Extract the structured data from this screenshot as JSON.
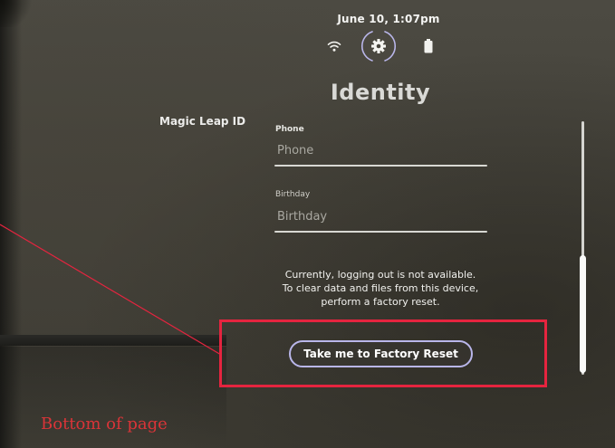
{
  "status_bar": {
    "date_time": "June 10, 1:07pm",
    "icons": [
      "wifi-icon",
      "settings-icon",
      "battery-icon"
    ]
  },
  "page": {
    "title": "Identity"
  },
  "sidebar": {
    "section_label": "Magic Leap ID"
  },
  "form": {
    "phone": {
      "caption": "Phone",
      "placeholder": "Phone"
    },
    "birthday": {
      "caption": "Birthday",
      "placeholder": "Birthday"
    }
  },
  "notice": {
    "line1": "Currently, logging out is not available.",
    "line2": "To clear data and files from this device,",
    "line3": "perform a factory reset."
  },
  "actions": {
    "factory_reset_label": "Take me to Factory Reset"
  },
  "annotation": {
    "caption": "Bottom of page",
    "color": "#e5243f"
  },
  "colors": {
    "background": "#46443c",
    "button_border": "#b9b6ea",
    "highlight": "#e5243f"
  }
}
